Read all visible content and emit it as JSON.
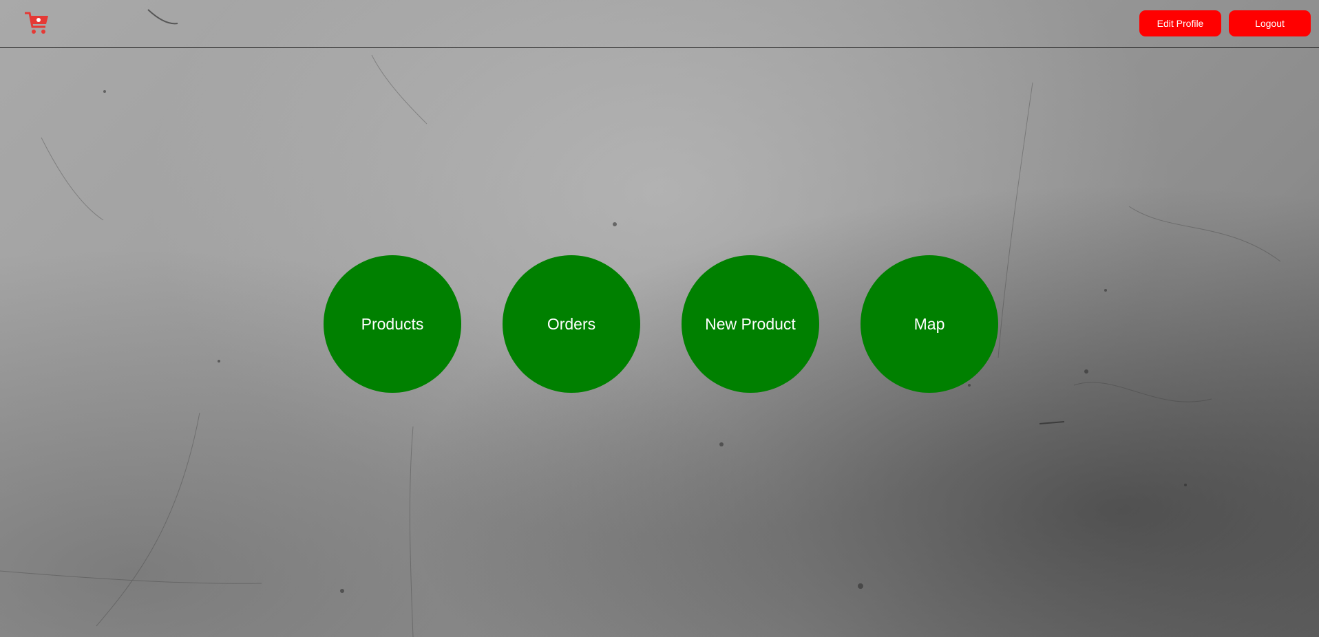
{
  "header": {
    "logo_icon": "shopping-cart-icon",
    "logo_color": "#e53935",
    "edit_profile_label": "Edit Profile",
    "logout_label": "Logout",
    "button_color": "#ff0000"
  },
  "menu": {
    "circle_color": "#008000",
    "items": [
      {
        "label": "Products"
      },
      {
        "label": "Orders"
      },
      {
        "label": "New Product"
      },
      {
        "label": "Map"
      }
    ]
  }
}
